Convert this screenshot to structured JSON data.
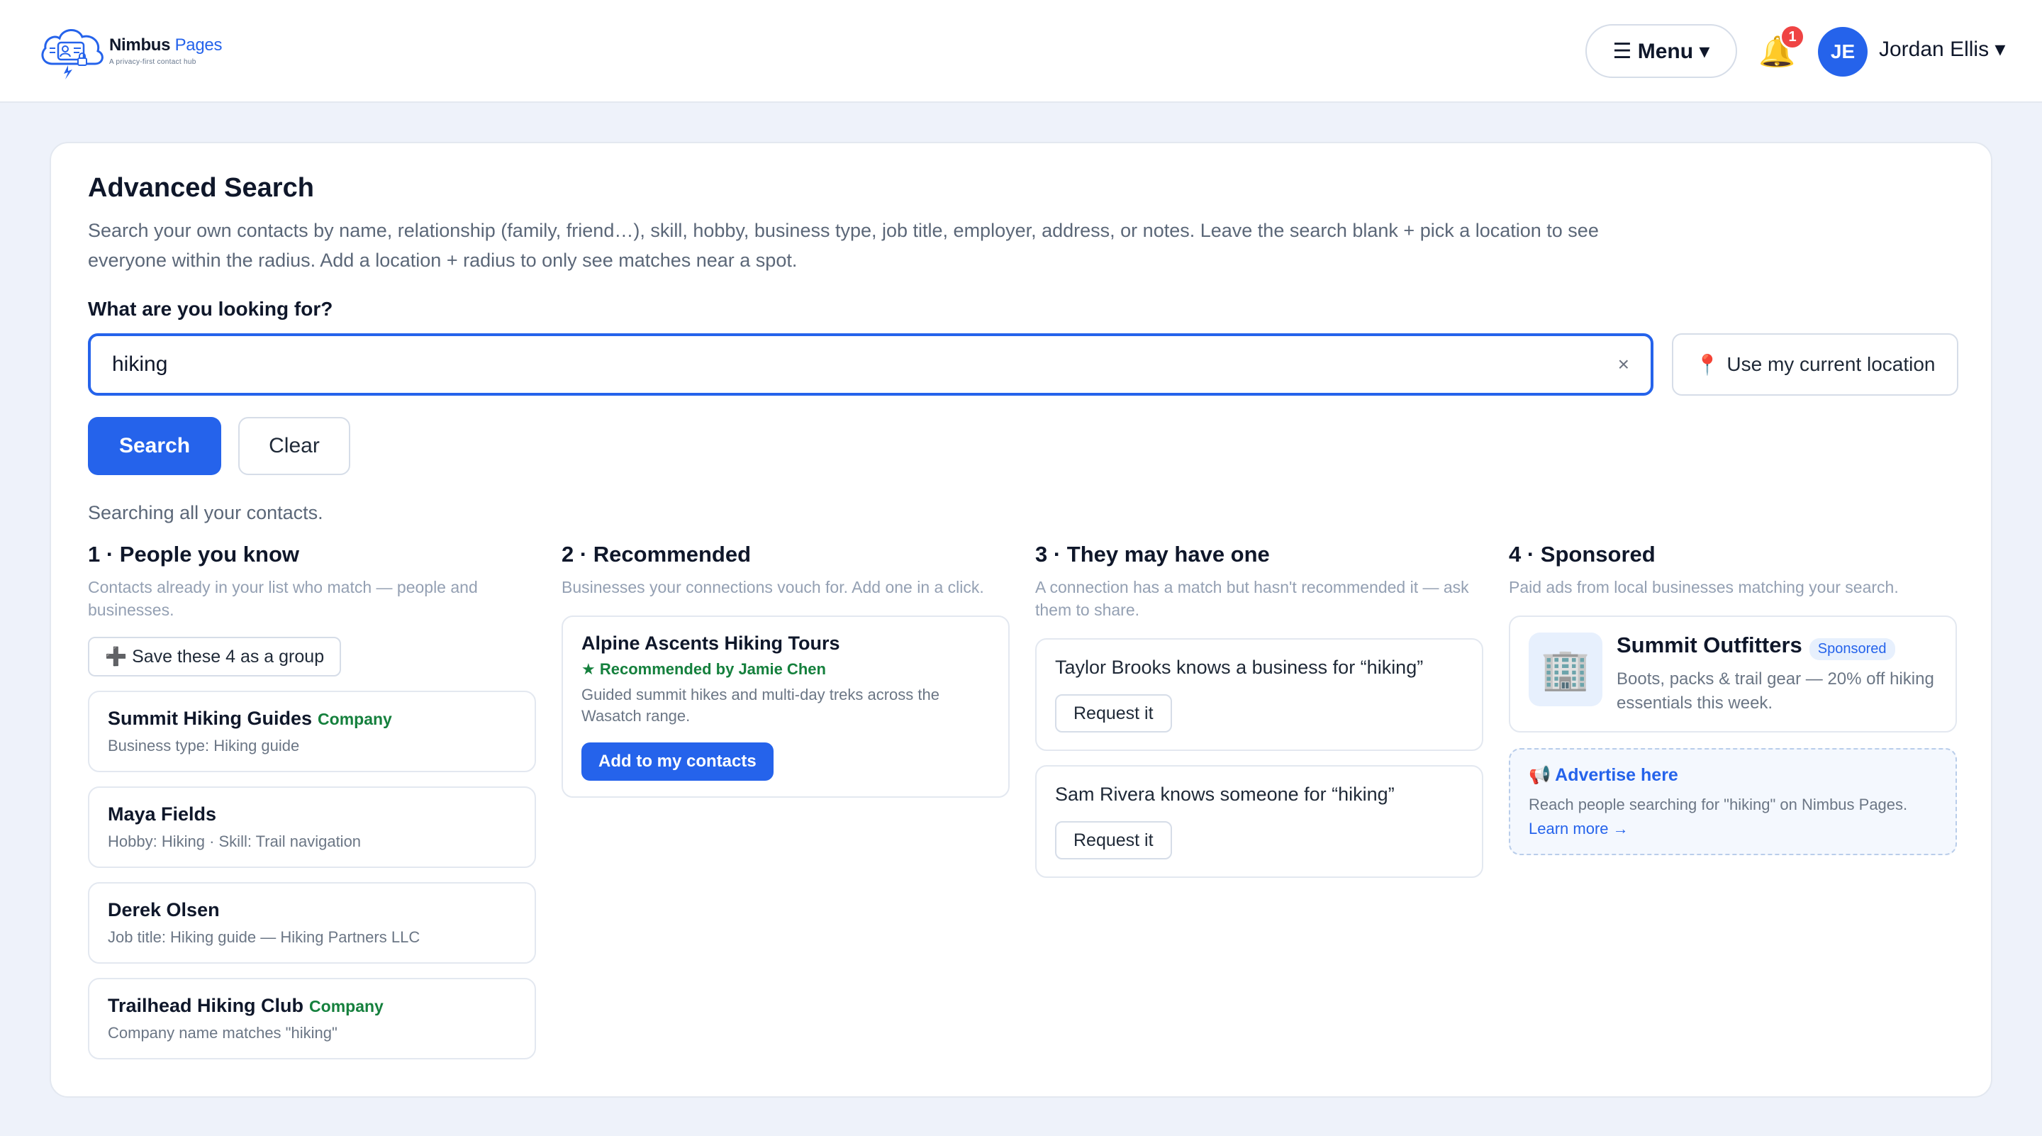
{
  "brand": {
    "name_first": "Nimbus",
    "name_second": "Pages",
    "tagline": "A privacy-first contact hub"
  },
  "header": {
    "menu_label": "☰ Menu ▾",
    "notification_count": "1",
    "avatar_initials": "JE",
    "user_name": "Jordan Ellis ▾"
  },
  "search": {
    "title": "Advanced Search",
    "description": "Search your own contacts by name, relationship (family, friend…), skill, hobby, business type, job title, employer, address, or notes. Leave the search blank + pick a location to see everyone within the radius. Add a location + radius to only see matches near a spot.",
    "field_label": "What are you looking for?",
    "value": "hiking",
    "clear_icon": "×",
    "location_button": "Use my current location",
    "search_button": "Search",
    "clear_button": "Clear",
    "status": "Searching all your contacts."
  },
  "columns": {
    "people": {
      "title": "1 · People you know",
      "subtitle": "Contacts already in your list who match — people and businesses.",
      "save_group": "➕ Save these 4 as a group",
      "items": [
        {
          "name": "Summit Hiking Guides",
          "tag": "Company",
          "detail": "Business type: Hiking guide"
        },
        {
          "name": "Maya Fields",
          "tag": "",
          "detail": "Hobby: Hiking · Skill: Trail navigation"
        },
        {
          "name": "Derek Olsen",
          "tag": "",
          "detail": "Job title: Hiking guide — Hiking Partners LLC"
        },
        {
          "name": "Trailhead Hiking Club",
          "tag": "Company",
          "detail": "Company name matches \"hiking\""
        }
      ]
    },
    "recommended": {
      "title": "2 · Recommended",
      "subtitle": "Businesses your connections vouch for. Add one in a click.",
      "card": {
        "name": "Alpine Ascents Hiking Tours",
        "recommended_by": "★ Recommended by Jamie Chen",
        "description": "Guided summit hikes and multi-day treks across the Wasatch range.",
        "button": "Add to my contacts"
      }
    },
    "maybe": {
      "title": "3 · They may have one",
      "subtitle": "A connection has a match but hasn't recommended it — ask them to share.",
      "items": [
        {
          "text": "Taylor Brooks knows a business for “hiking”",
          "button": "Request it"
        },
        {
          "text": "Sam Rivera knows someone for “hiking”",
          "button": "Request it"
        }
      ]
    },
    "sponsored": {
      "title": "4 · Sponsored",
      "subtitle": "Paid ads from local businesses matching your search.",
      "ad": {
        "name": "Summit Outfitters",
        "badge": "Sponsored",
        "description": "Boots, packs & trail gear — 20% off hiking essentials this week."
      },
      "advertise": {
        "title": "📢 Advertise here",
        "text": "Reach people searching for \"hiking\" on Nimbus Pages.",
        "link": "Learn more →"
      }
    }
  },
  "colors": {
    "accent": "#2563eb",
    "success": "#15803d",
    "badge": "#ef4444"
  }
}
